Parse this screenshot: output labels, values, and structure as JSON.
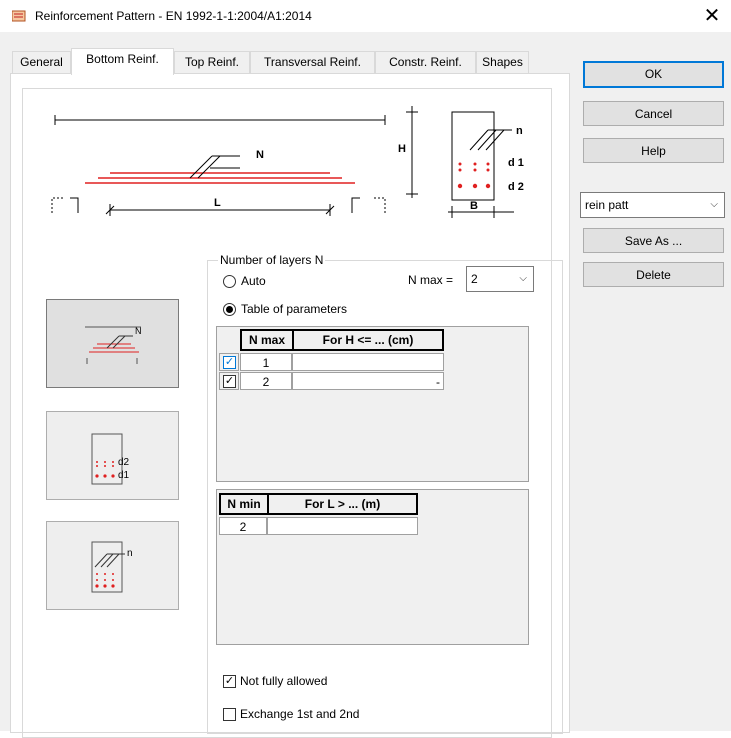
{
  "window": {
    "title": "Reinforcement Pattern - EN 1992-1-1:2004/A1:2014",
    "close_glyph": "✕"
  },
  "tabs": [
    {
      "label": "General"
    },
    {
      "label": "Bottom Reinf."
    },
    {
      "label": "Top Reinf."
    },
    {
      "label": "Transversal Reinf."
    },
    {
      "label": "Constr. Reinf."
    },
    {
      "label": "Shapes"
    }
  ],
  "diagram": {
    "label_N": "N",
    "label_L": "L",
    "label_H": "H",
    "label_B": "B",
    "label_n": "n",
    "label_d1": "d 1",
    "label_d2": "d 2"
  },
  "side_images": [
    {
      "label": "N"
    },
    {
      "label_d2": "d2",
      "label_d1": "d1"
    },
    {
      "label": "n"
    }
  ],
  "layers": {
    "group_label": "Number of layers N",
    "auto_label": "Auto",
    "table_label": "Table of parameters",
    "nmax_label": "N max =",
    "nmax_value": "2",
    "selected": "table"
  },
  "table_h": {
    "headers": [
      "N max",
      "For H <= ... (cm)"
    ],
    "rows": [
      {
        "checked": true,
        "nmax": "1",
        "h": ""
      },
      {
        "checked": true,
        "nmax": "2",
        "h": "-"
      }
    ]
  },
  "table_l": {
    "headers": [
      "N min",
      "For L > ... (m)"
    ],
    "rows": [
      {
        "nmin": "2",
        "l": ""
      }
    ]
  },
  "options": {
    "not_fully_allowed": {
      "label": "Not fully allowed",
      "checked": true
    },
    "exchange": {
      "label": "Exchange 1st and 2nd",
      "checked": false
    }
  },
  "buttons": {
    "ok": "OK",
    "cancel": "Cancel",
    "help": "Help",
    "save_as": "Save As ...",
    "delete": "Delete"
  },
  "pattern_select": {
    "value": "rein patt"
  },
  "colors": {
    "accent": "#0078d7",
    "rebar": "#e02020",
    "button_face": "#e1e1e1",
    "window_bg": "#f0f0f0"
  }
}
